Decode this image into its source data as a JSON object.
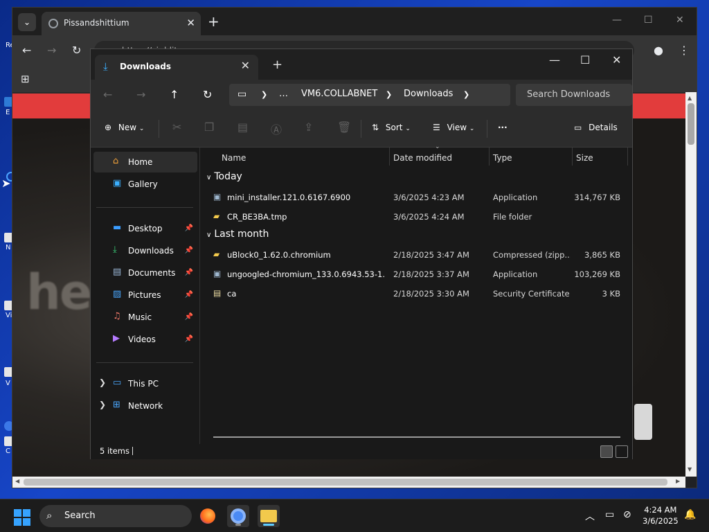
{
  "browser": {
    "tab_title": "Pissandshittium",
    "url_fragment": "https://ci      ddit",
    "new_tab_label": "+"
  },
  "explorer": {
    "tab_title": "Downloads",
    "breadcrumbs": [
      "…",
      "VM6.COLLABNET",
      "Downloads"
    ],
    "search_placeholder": "Search Downloads",
    "commands": {
      "new": "New",
      "sort": "Sort",
      "view": "View",
      "more": "···",
      "details": "Details"
    },
    "nav": {
      "items": [
        {
          "label": "Home",
          "icon": "home-icon",
          "selected": true
        },
        {
          "label": "Gallery",
          "icon": "gallery-icon"
        },
        {
          "label": "Desktop",
          "icon": "desktop-icon",
          "pinned": true
        },
        {
          "label": "Downloads",
          "icon": "download-icon",
          "pinned": true
        },
        {
          "label": "Documents",
          "icon": "documents-icon",
          "pinned": true
        },
        {
          "label": "Pictures",
          "icon": "pictures-icon",
          "pinned": true
        },
        {
          "label": "Music",
          "icon": "music-icon",
          "pinned": true
        },
        {
          "label": "Videos",
          "icon": "videos-icon",
          "pinned": true
        },
        {
          "label": "This PC",
          "icon": "computer-icon",
          "expandable": true
        },
        {
          "label": "Network",
          "icon": "network-icon",
          "expandable": true
        }
      ]
    },
    "columns": [
      "Name",
      "Date modified",
      "Type",
      "Size"
    ],
    "groups": [
      {
        "label": "Today",
        "files": [
          {
            "name": "mini_installer.121.0.6167.6900",
            "date": "3/6/2025 4:23 AM",
            "type": "Application",
            "size": "314,767 KB",
            "icon": "application-icon"
          },
          {
            "name": "CR_BE3BA.tmp",
            "date": "3/6/2025 4:24 AM",
            "type": "File folder",
            "size": "",
            "icon": "folder-icon"
          }
        ]
      },
      {
        "label": "Last month",
        "files": [
          {
            "name": "uBlock0_1.62.0.chromium",
            "date": "2/18/2025 3:47 AM",
            "type": "Compressed (zipp...",
            "size": "3,865 KB",
            "icon": "zip-folder-icon"
          },
          {
            "name": "ungoogled-chromium_133.0.6943.53-1.1...",
            "date": "2/18/2025 3:37 AM",
            "type": "Application",
            "size": "103,269 KB",
            "icon": "application-icon"
          },
          {
            "name": "ca",
            "date": "2/18/2025 3:30 AM",
            "type": "Security Certificate",
            "size": "3 KB",
            "icon": "certificate-icon"
          }
        ]
      }
    ],
    "status": "5 items"
  },
  "taskbar": {
    "search_label": "Search",
    "time": "4:24 AM",
    "date": "3/6/2025"
  },
  "desktop_labels": [
    "Re",
    "E",
    "N",
    "Vis",
    "V",
    "C"
  ],
  "colors": {
    "accent": "#60cdff",
    "download_icon": "#3bb0ff",
    "page_red_bar": "#e23c3c",
    "folder": "#f2c94c"
  }
}
